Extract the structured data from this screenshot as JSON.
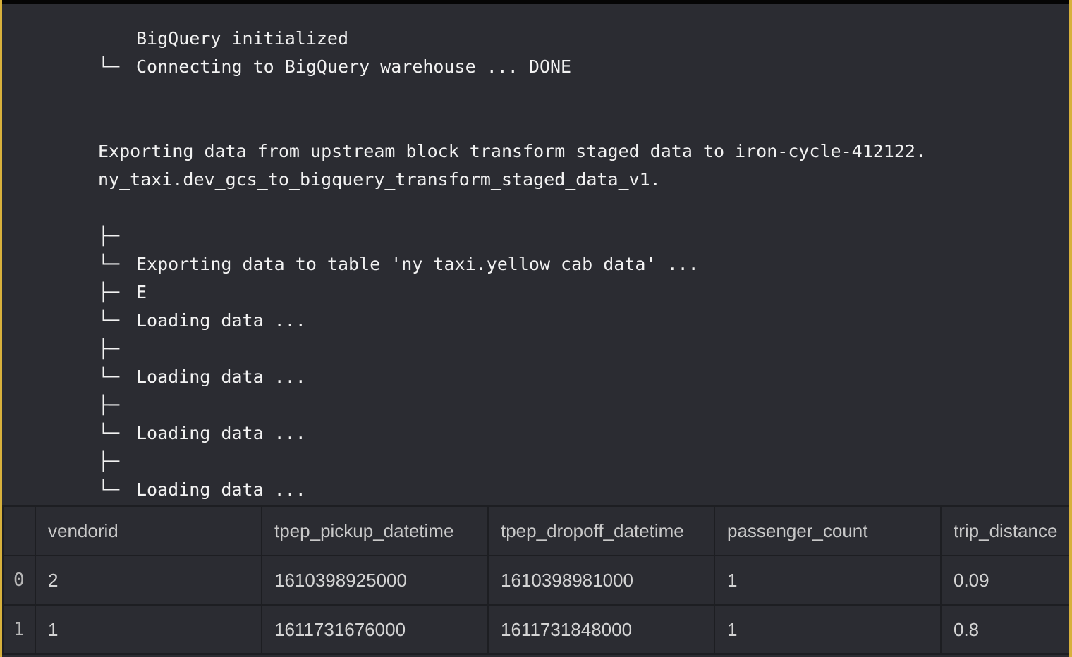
{
  "log": {
    "lines": [
      {
        "tree": "",
        "text": "BigQuery initialized"
      },
      {
        "tree": "└─",
        "text": "Connecting to BigQuery warehouse ... DONE"
      },
      {
        "tree": "",
        "text": "Exporting data from upstream block transform_staged_data to iron-cycle-412122."
      },
      {
        "tree": "",
        "text": "ny_taxi.dev_gcs_to_bigquery_transform_staged_data_v1."
      },
      {
        "tree": "├─",
        "text": ""
      },
      {
        "tree": "└─",
        "text": "Exporting data to table 'ny_taxi.yellow_cab_data' ..."
      },
      {
        "tree": "├─",
        "text": "E"
      },
      {
        "tree": "└─",
        "text": "Loading data ..."
      },
      {
        "tree": "├─",
        "text": ""
      },
      {
        "tree": "└─",
        "text": "Loading data ..."
      },
      {
        "tree": "├─",
        "text": ""
      },
      {
        "tree": "└─",
        "text": "Loading data ..."
      },
      {
        "tree": "├─",
        "text": ""
      },
      {
        "tree": "└─",
        "text": "Loading data ..."
      }
    ]
  },
  "table": {
    "columns": [
      "",
      "vendorid",
      "tpep_pickup_datetime",
      "tpep_dropoff_datetime",
      "passenger_count",
      "trip_distance"
    ],
    "rows": [
      [
        "0",
        "2",
        "1610398925000",
        "1610398981000",
        "1",
        "0.09"
      ],
      [
        "1",
        "1",
        "1611731676000",
        "1611731848000",
        "1",
        "0.8"
      ]
    ]
  }
}
